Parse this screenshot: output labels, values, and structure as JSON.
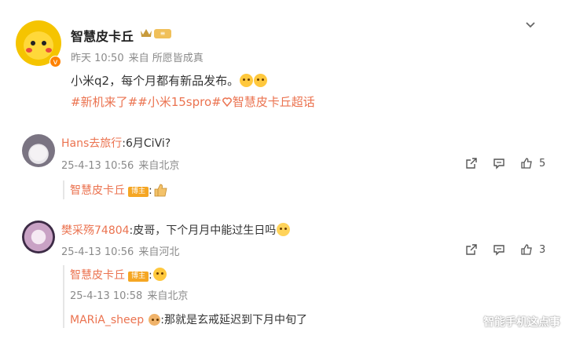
{
  "post": {
    "author": "智慧皮卡丘",
    "level_badge": "≡",
    "time": "昨天 10:50",
    "source": "来自 所愿皆成真",
    "text": "小米q2，每个月都有新品发布。",
    "tags": [
      "#新机来了#",
      "#小米15spro#",
      "智慧皮卡丘超话"
    ]
  },
  "comments": [
    {
      "user": "Hans去旅行",
      "text": ":6月CiVi?",
      "time": "25-4-13 10:56",
      "location": "来自北京",
      "likes": "5",
      "reply": {
        "user": "智慧皮卡丘",
        "tag": "博主",
        "text": ":"
      }
    },
    {
      "user": "樊采殇74804",
      "text": ":皮哥，下个月月中能过生日吗",
      "time": "25-4-13 10:56",
      "location": "来自河北",
      "likes": "3",
      "reply": {
        "user": "智慧皮卡丘",
        "tag": "博主",
        "text": ":",
        "time": "25-4-13 10:58",
        "location": "来自北京"
      },
      "reply2": {
        "user": "MARiA_sheep",
        "text": ":那就是玄戒延迟到下月中旬了"
      }
    }
  ],
  "watermark": "智能手机这点事",
  "colors": {
    "link": "#eb7350",
    "meta": "#8a8a8a",
    "verified": "#ff8200"
  }
}
